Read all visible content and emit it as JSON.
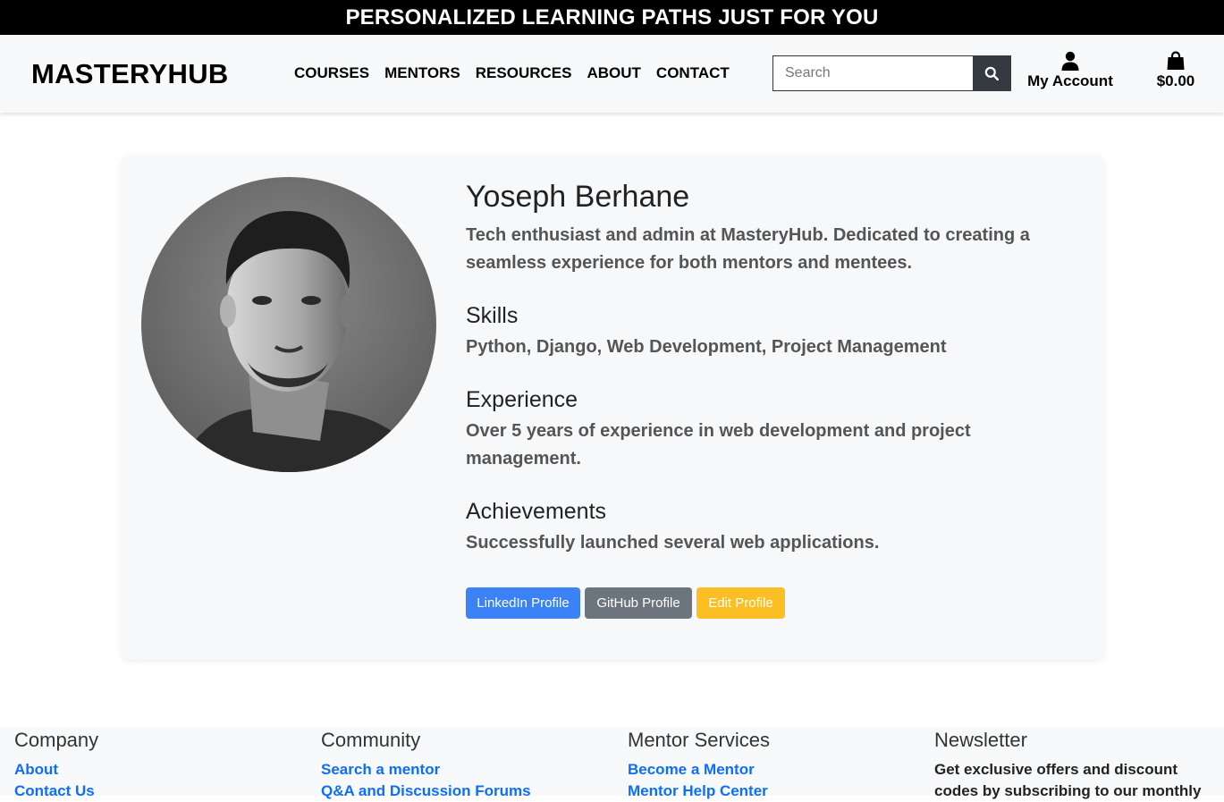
{
  "banner": {
    "text": "PERSONALIZED LEARNING PATHS JUST FOR YOU"
  },
  "header": {
    "brand": "MASTERYHUB",
    "nav": [
      "COURSES",
      "MENTORS",
      "RESOURCES",
      "ABOUT",
      "CONTACT"
    ],
    "search": {
      "placeholder": "Search",
      "value": ""
    },
    "account_label": "My Account",
    "cart_total": "$0.00",
    "icons": {
      "search": "search-icon",
      "account": "user-icon",
      "cart": "shopping-bag-icon"
    }
  },
  "profile": {
    "name": "Yoseph Berhane",
    "bio": "Tech enthusiast and admin at MasteryHub. Dedicated to creating a seamless experience for both mentors and mentees.",
    "sections": [
      {
        "title": "Skills",
        "text": "Python, Django, Web Development, Project Management"
      },
      {
        "title": "Experience",
        "text": "Over 5 years of experience in web development and project management."
      },
      {
        "title": "Achievements",
        "text": "Successfully launched several web applications."
      }
    ],
    "buttons": {
      "linkedin": "LinkedIn Profile",
      "github": "GitHub Profile",
      "edit": "Edit Profile"
    }
  },
  "footer": {
    "columns": [
      {
        "title": "Company",
        "links": [
          "About",
          "Contact Us"
        ]
      },
      {
        "title": "Community",
        "links": [
          "Search a mentor",
          "Q&A and Discussion Forums"
        ]
      },
      {
        "title": "Mentor Services",
        "links": [
          "Become a Mentor",
          "Mentor Help Center"
        ]
      }
    ],
    "newsletter": {
      "title": "Newsletter",
      "text": "Get exclusive offers and discount codes by subscribing to our monthly"
    }
  },
  "colors": {
    "linkedin": "#3b82f6",
    "github": "#6c757d",
    "edit": "#fbbf24",
    "link": "#0d6efd",
    "dark": "#343a40"
  }
}
